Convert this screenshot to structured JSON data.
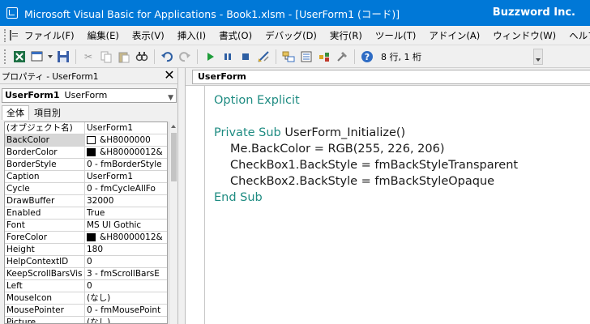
{
  "window": {
    "title": "Microsoft Visual Basic for Applications - Book1.xlsm - [UserForm1 (コード)]",
    "brand": "Buzzword Inc."
  },
  "menu": {
    "items": [
      "ファイル(F)",
      "編集(E)",
      "表示(V)",
      "挿入(I)",
      "書式(O)",
      "デバッグ(D)",
      "実行(R)",
      "ツール(T)",
      "アドイン(A)",
      "ウィンドウ(W)",
      "ヘルプ(H)"
    ]
  },
  "toolbar": {
    "position_text": "8 行, 1 桁"
  },
  "properties": {
    "header": "プロパティ - UserForm1",
    "object_name": "UserForm1",
    "object_class": "UserForm",
    "tabs": [
      "全体",
      "項目別"
    ],
    "rows": [
      {
        "name": "(オブジェクト名)",
        "value": "UserForm1"
      },
      {
        "name": "BackColor",
        "value": "&H8000000",
        "swatch": "#ffffff"
      },
      {
        "name": "BorderColor",
        "value": "&H80000012&",
        "swatch": "#000000"
      },
      {
        "name": "BorderStyle",
        "value": "0 - fmBorderStyle"
      },
      {
        "name": "Caption",
        "value": "UserForm1"
      },
      {
        "name": "Cycle",
        "value": "0 - fmCycleAllFo"
      },
      {
        "name": "DrawBuffer",
        "value": "32000"
      },
      {
        "name": "Enabled",
        "value": "True"
      },
      {
        "name": "Font",
        "value": "MS UI Gothic"
      },
      {
        "name": "ForeColor",
        "value": "&H80000012&",
        "swatch": "#000000"
      },
      {
        "name": "Height",
        "value": "180"
      },
      {
        "name": "HelpContextID",
        "value": "0"
      },
      {
        "name": "KeepScrollBarsVis",
        "value": "3 - fmScrollBarsE"
      },
      {
        "name": "Left",
        "value": "0"
      },
      {
        "name": "MouseIcon",
        "value": "(なし)"
      },
      {
        "name": "MousePointer",
        "value": "0 - fmMousePoint"
      },
      {
        "name": "Picture",
        "value": "(なし)"
      }
    ]
  },
  "code": {
    "object_dropdown": "UserForm",
    "lines": [
      {
        "parts": [
          {
            "t": "Option Explicit",
            "c": "kw"
          }
        ]
      },
      {
        "parts": [
          {
            "t": "",
            "c": "id"
          }
        ]
      },
      {
        "parts": [
          {
            "t": "Private Sub ",
            "c": "kw"
          },
          {
            "t": "UserForm_Initialize()",
            "c": "id"
          }
        ]
      },
      {
        "parts": [
          {
            "t": "Me.BackColor = RGB(255, 226, 206)",
            "c": "id"
          }
        ],
        "indent": true
      },
      {
        "parts": [
          {
            "t": "CheckBox1.BackStyle = fmBackStyleTransparent",
            "c": "id"
          }
        ],
        "indent": true
      },
      {
        "parts": [
          {
            "t": "CheckBox2.BackStyle = fmBackStyleOpaque",
            "c": "id"
          }
        ],
        "indent": true
      },
      {
        "parts": [
          {
            "t": "End Sub",
            "c": "kw"
          }
        ]
      }
    ]
  },
  "colors": {
    "titlebar": "#0078d7",
    "keyword": "#1f8c82"
  }
}
